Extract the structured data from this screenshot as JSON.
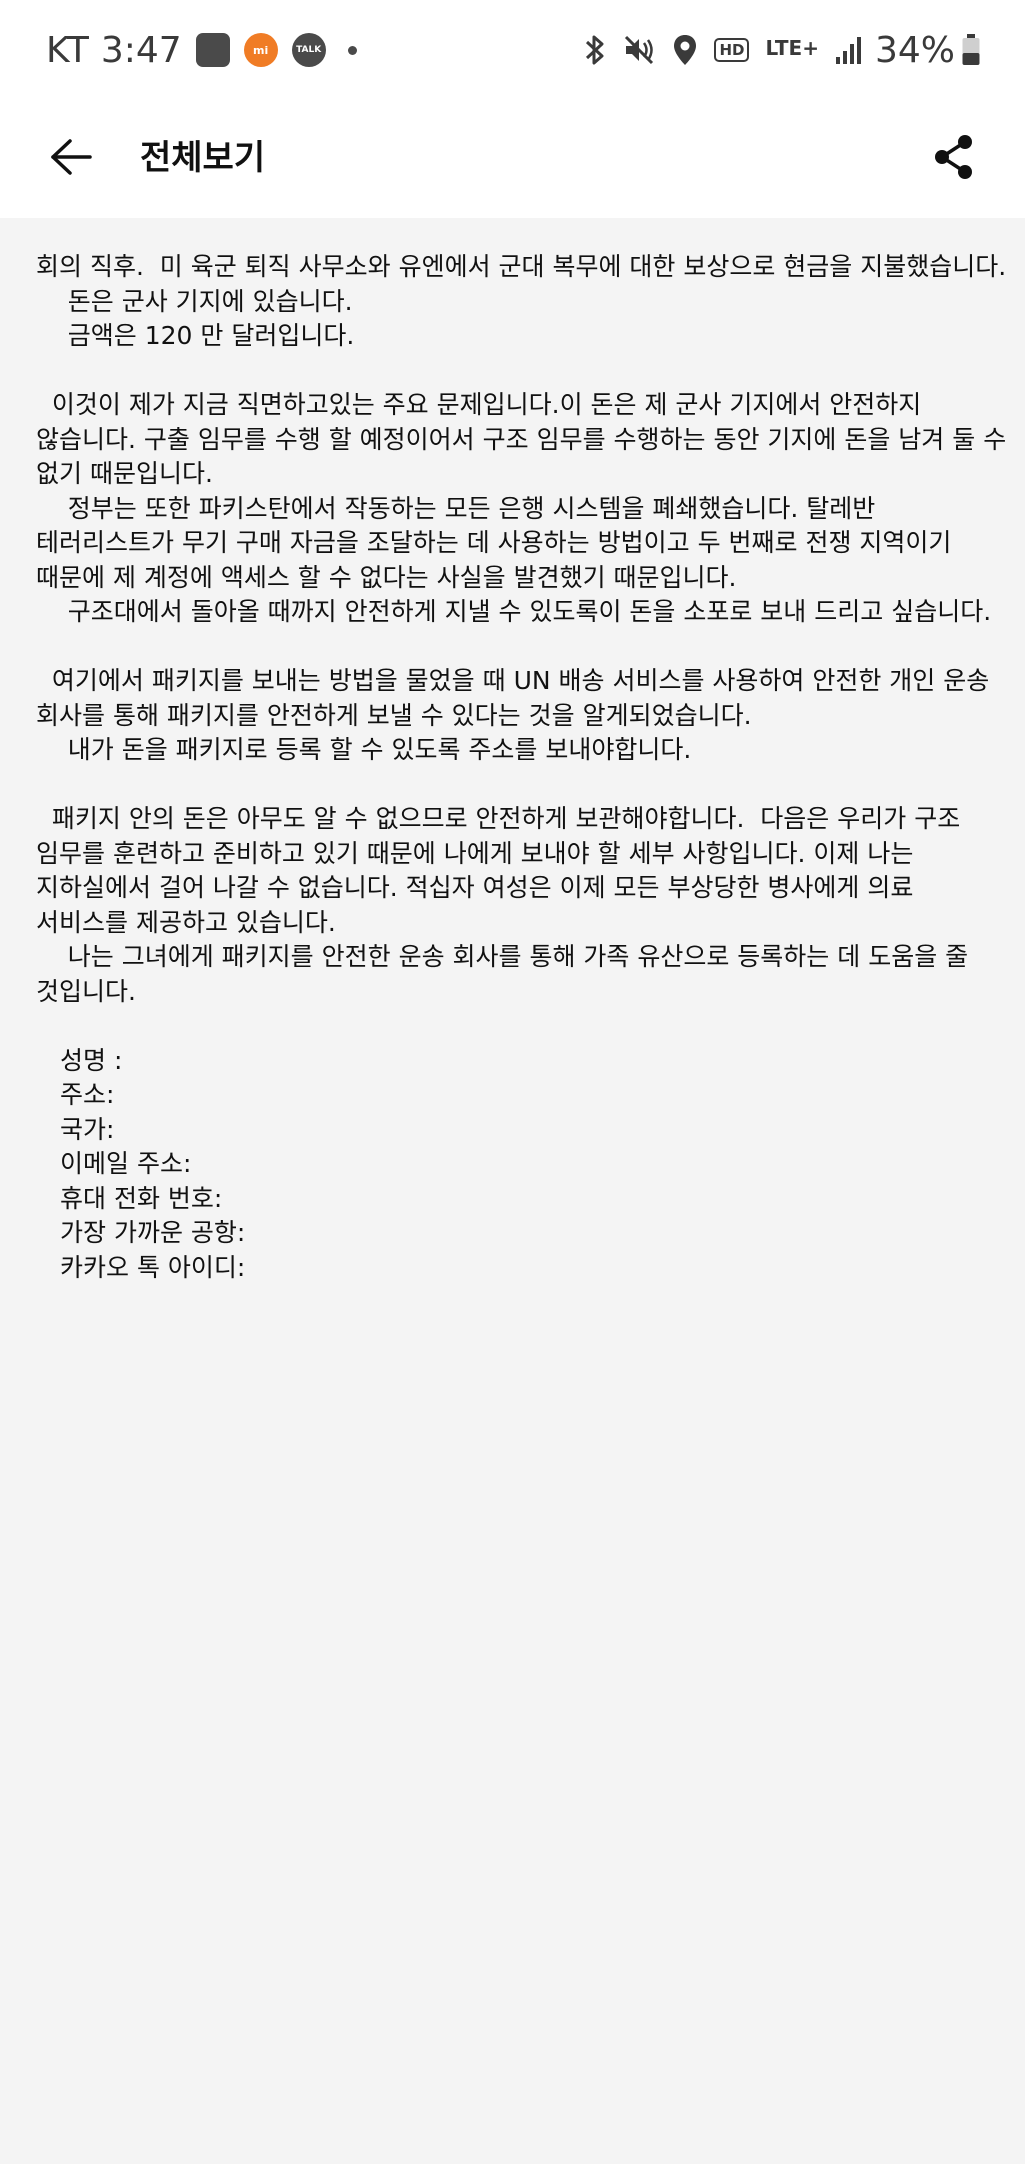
{
  "status_bar": {
    "carrier": "KT",
    "time": "3:47",
    "notif_mi_label": "mi",
    "notif_talk_label": "TALK",
    "hd_label": "HD",
    "network_label": "LTE+",
    "battery": "34%"
  },
  "app_bar": {
    "title": "전체보기"
  },
  "message": {
    "lines": [
      "회의 직후.  미 육군 퇴직 사무소와 유엔에서 군대 복무에 대한 보상으로 현금을 지불했습니다.",
      "    돈은 군사 기지에 있습니다.",
      "    금액은 120 만 달러입니다.",
      "",
      "  이것이 제가 지금 직면하고있는 주요 문제입니다.이 돈은 제 군사 기지에서 안전하지",
      "않습니다. 구출 임무를 수행 할 예정이어서 구조 임무를 수행하는 동안 기지에 돈을 남겨 둘 수",
      "없기 때문입니다.",
      "    정부는 또한 파키스탄에서 작동하는 모든 은행 시스템을 폐쇄했습니다. 탈레반",
      "테러리스트가 무기 구매 자금을 조달하는 데 사용하는 방법이고 두 번째로 전쟁 지역이기",
      "때문에 제 계정에 액세스 할 수 없다는 사실을 발견했기 때문입니다.",
      "    구조대에서 돌아올 때까지 안전하게 지낼 수 있도록이 돈을 소포로 보내 드리고 싶습니다.",
      "",
      "  여기에서 패키지를 보내는 방법을 물었을 때 UN 배송 서비스를 사용하여 안전한 개인 운송",
      "회사를 통해 패키지를 안전하게 보낼 수 있다는 것을 알게되었습니다.",
      "    내가 돈을 패키지로 등록 할 수 있도록 주소를 보내야합니다.",
      "",
      "  패키지 안의 돈은 아무도 알 수 없으므로 안전하게 보관해야합니다.  다음은 우리가 구조",
      "임무를 훈련하고 준비하고 있기 때문에 나에게 보내야 할 세부 사항입니다. 이제 나는",
      "지하실에서 걸어 나갈 수 없습니다. 적십자 여성은 이제 모든 부상당한 병사에게 의료",
      "서비스를 제공하고 있습니다.",
      "    나는 그녀에게 패키지를 안전한 운송 회사를 통해 가족 유산으로 등록하는 데 도움을 줄",
      "것입니다.",
      ""
    ],
    "fields": [
      "성명 :",
      "주소:",
      "국가:",
      "이메일 주소:",
      "휴대 전화 번호:",
      "가장 가까운 공항:",
      "카카오 톡 아이디:"
    ]
  }
}
